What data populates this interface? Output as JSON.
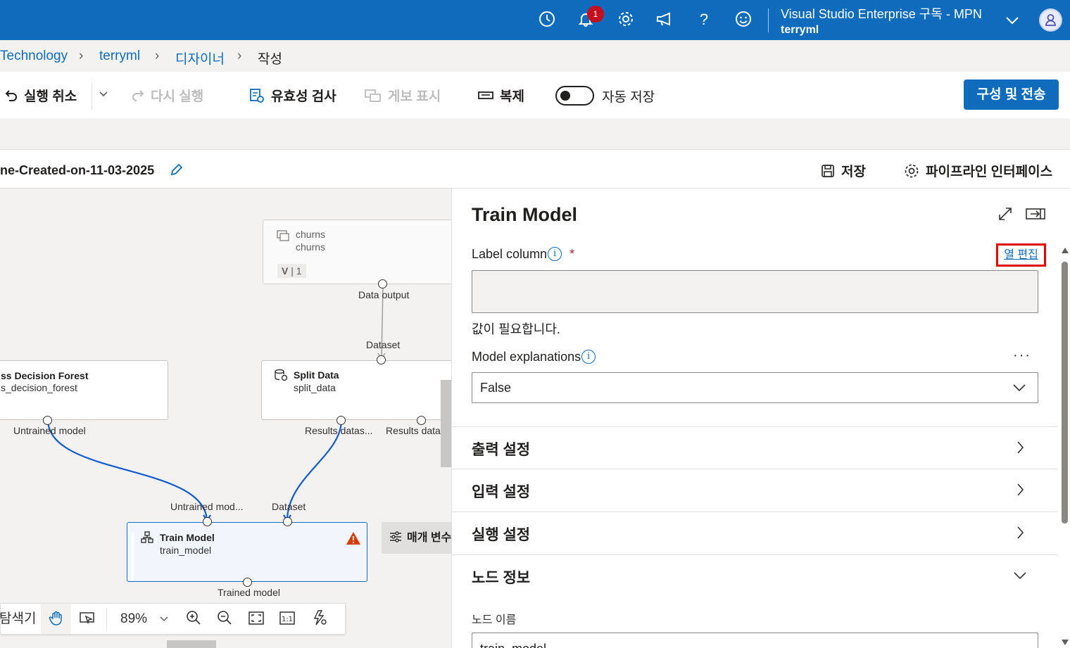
{
  "topbar": {
    "notification_count": "1",
    "subscription": "Visual Studio Enterprise 구독 - MPN",
    "user": "terryml",
    "icons": [
      "clock-icon",
      "bell-icon",
      "gear-icon",
      "megaphone-icon",
      "help-icon",
      "smiley-icon",
      "chevron-down-icon",
      "avatar-icon"
    ]
  },
  "breadcrumb": {
    "items": [
      "Technology",
      "terryml",
      "디자이너",
      "작성"
    ]
  },
  "toolbar": {
    "undo": "실행 취소",
    "redo": "다시 실행",
    "validate": "유효성 검사",
    "publish": "게보 표시",
    "clone": "복제",
    "autosave": "자동 저장",
    "autosave_on": false,
    "submit": "구성 및 전송"
  },
  "pipeline": {
    "title": "ne-Created-on-11-03-2025",
    "save": "저장",
    "interface": "파이프라인 인터페이스"
  },
  "canvas": {
    "nodes": {
      "churns": {
        "title": "churns",
        "subtitle": "churns",
        "version_label": "V",
        "version": "1",
        "output": "Data output"
      },
      "split": {
        "title": "Split Data",
        "subtitle": "split_data",
        "input": "Dataset",
        "output1": "Results datas...",
        "output2": "Results data"
      },
      "forest": {
        "title": "ss Decision Forest",
        "subtitle": "s_decision_forest",
        "output": "Untrained model"
      },
      "train": {
        "title": "Train Model",
        "subtitle": "train_model",
        "input1": "Untrained mod...",
        "input2": "Dataset",
        "output": "Trained model"
      }
    },
    "parameters_button": "매개 변수",
    "zoom": {
      "navigator": "탐색기",
      "level": "89%"
    }
  },
  "panel": {
    "title": "Train Model",
    "label_column": "Label column",
    "required_mark": "*",
    "edit_columns": "열 편집",
    "required_msg": "값이 필요합니다.",
    "model_explanations": "Model explanations",
    "more": "···",
    "model_explanations_value": "False",
    "sections": [
      "출력 설정",
      "입력 설정",
      "실행 설정",
      "노드 정보"
    ],
    "node_name_label": "노드 이름",
    "node_name_value": "train_model"
  },
  "colors": {
    "accent": "#0f6cbd",
    "edge": "#0f5bd0",
    "highlight_box": "#e00000",
    "warning": "#d83b01"
  }
}
